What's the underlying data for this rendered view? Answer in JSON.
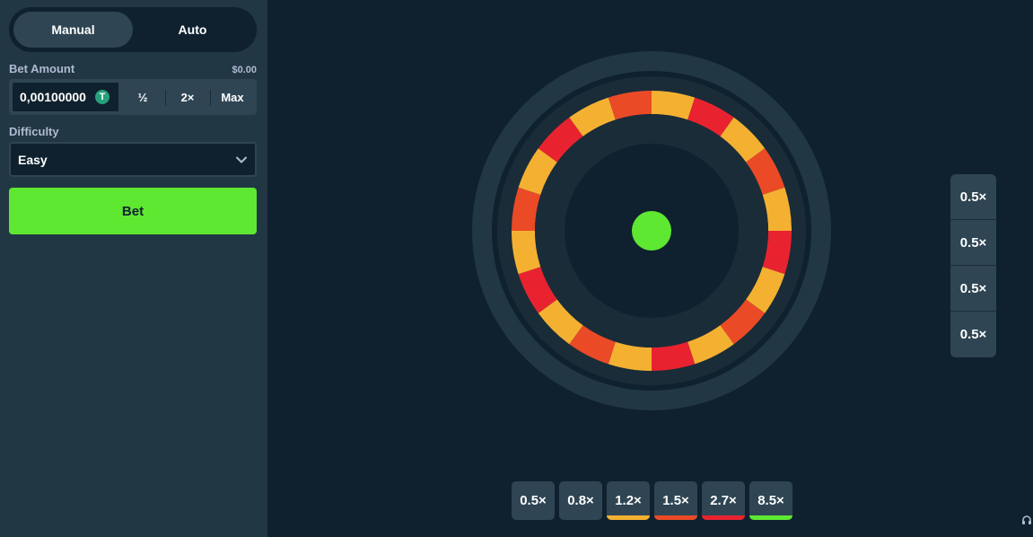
{
  "sidebar": {
    "modes": [
      {
        "label": "Manual",
        "active": true
      },
      {
        "label": "Auto",
        "active": false
      }
    ],
    "bet_amount": {
      "label": "Bet Amount",
      "usd_value": "$0.00",
      "value": "0,00100000",
      "coin_icon": "tether-icon",
      "coin_symbol": "T",
      "half_label": "½",
      "double_label": "2×",
      "max_label": "Max"
    },
    "difficulty": {
      "label": "Difficulty",
      "selected": "Easy",
      "icon": "chevron-down-icon"
    },
    "bet_button_label": "Bet"
  },
  "wheel": {
    "segment_colors": [
      "#f4b131",
      "#e8232f",
      "#f4b131",
      "#eb4a27",
      "#f4b131",
      "#e8232f",
      "#f4b131",
      "#eb4a27",
      "#f4b131",
      "#e8232f",
      "#f4b131",
      "#eb4a27",
      "#f4b131",
      "#e8232f",
      "#f4b131",
      "#eb4a27",
      "#f4b131",
      "#e8232f",
      "#f4b131",
      "#eb4a27"
    ],
    "center_color": "#5ee832"
  },
  "multiplier_stack": [
    "0.5×",
    "0.5×",
    "0.5×",
    "0.5×"
  ],
  "payouts": [
    {
      "label": "0.5×",
      "color": ""
    },
    {
      "label": "0.8×",
      "color": ""
    },
    {
      "label": "1.2×",
      "color": "#f4b131"
    },
    {
      "label": "1.5×",
      "color": "#eb4a27"
    },
    {
      "label": "2.7×",
      "color": "#e8232f"
    },
    {
      "label": "8.5×",
      "color": "#5ee832"
    }
  ],
  "colors": {
    "background": "#0f212e",
    "sidebar": "#213743",
    "accent_green": "#5ee832"
  }
}
